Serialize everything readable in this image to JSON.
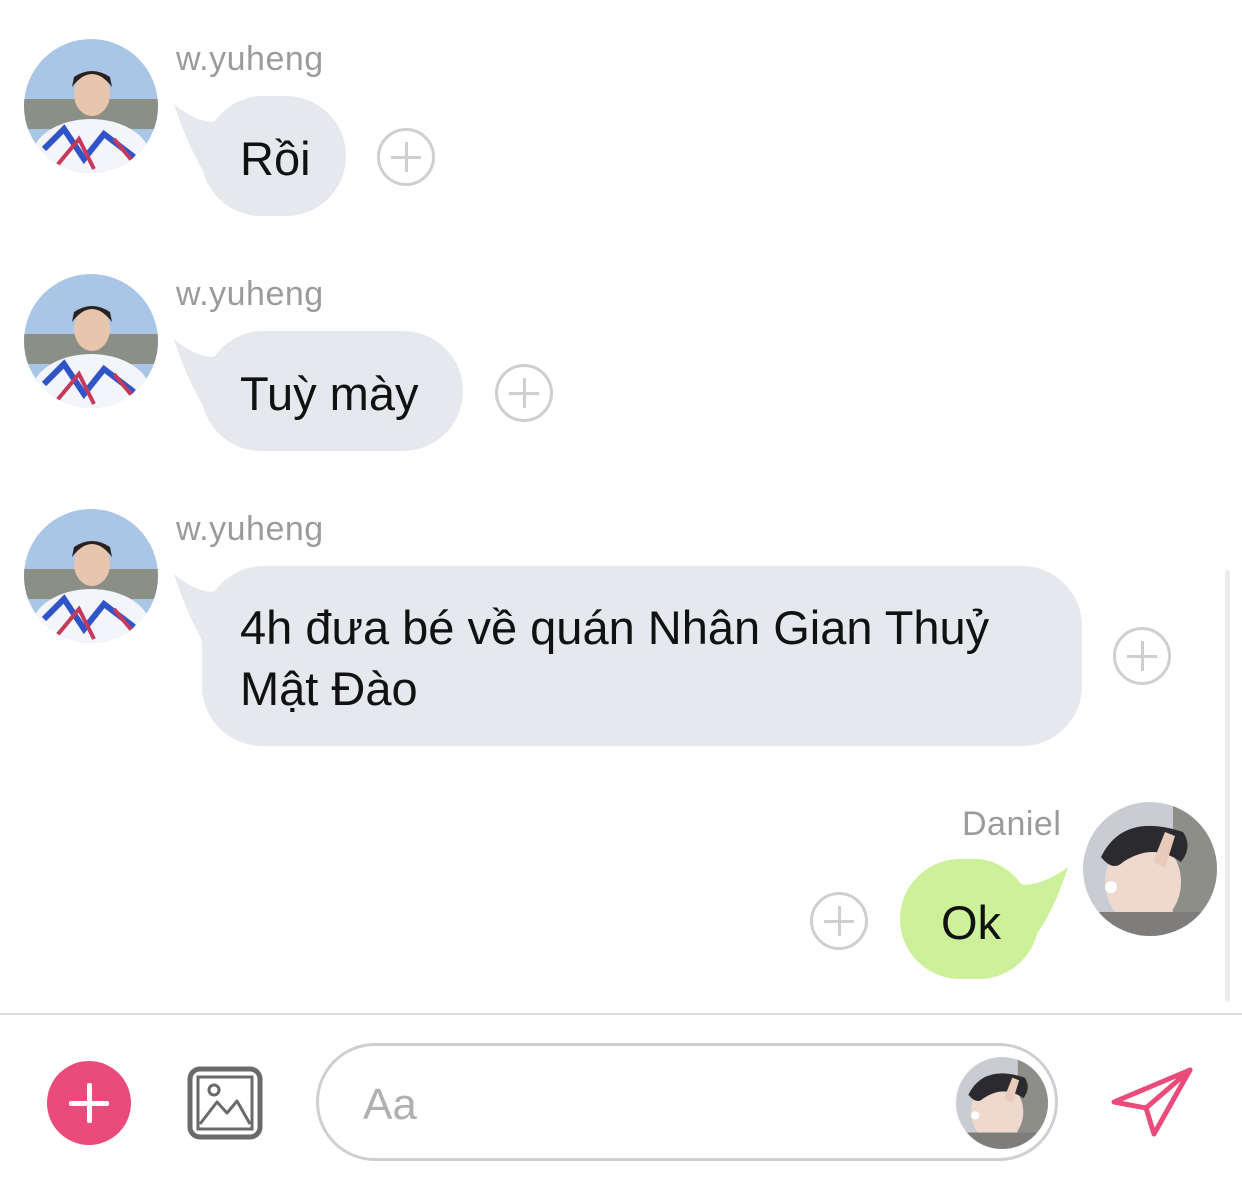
{
  "messages": [
    {
      "sender": "w.yuheng",
      "text": "Rồi",
      "side": "left",
      "avatar": "w.yuheng-avatar"
    },
    {
      "sender": "w.yuheng",
      "text": "Tuỳ mày",
      "side": "left",
      "avatar": "w.yuheng-avatar"
    },
    {
      "sender": "w.yuheng",
      "text_line1": "4h đưa bé về quán Nhân Gian Thuỷ",
      "text_line2": "Mật Đào",
      "side": "left",
      "avatar": "w.yuheng-avatar"
    },
    {
      "sender": "Daniel",
      "text": "Ok",
      "side": "right",
      "avatar": "daniel-avatar"
    }
  ],
  "composer": {
    "placeholder": "Aa",
    "icons": [
      "plus-icon",
      "image-icon",
      "send-icon"
    ]
  },
  "colors": {
    "incoming_bubble": "#e5e8ec",
    "outgoing_bubble": "#cdf09a",
    "accent": "#ea4b7b",
    "icon_gray": "#6a6a6a"
  }
}
